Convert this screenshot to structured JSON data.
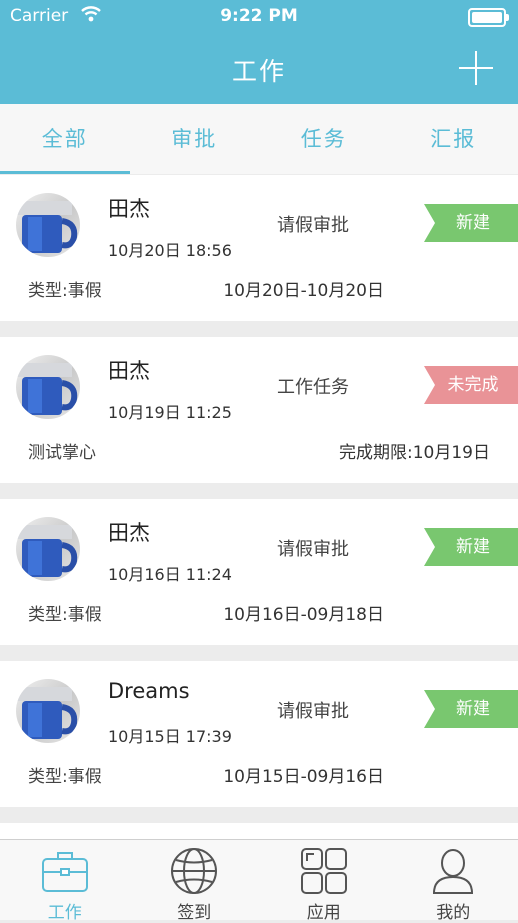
{
  "status": {
    "carrier": "Carrier",
    "time": "9:22 PM"
  },
  "header": {
    "title": "工作"
  },
  "tabs": [
    "全部",
    "审批",
    "任务",
    "汇报"
  ],
  "items": [
    {
      "name": "田杰",
      "datetime": "10月20日 18:56",
      "kind": "请假审批",
      "badge": "新建",
      "badge_color": "#79c76f",
      "left": "类型:事假",
      "right": "10月20日-10月20日"
    },
    {
      "name": "田杰",
      "datetime": "10月19日 11:25",
      "kind": "工作任务",
      "badge": "未完成",
      "badge_color": "#e99397",
      "left": "测试掌心",
      "right": "完成期限:10月19日"
    },
    {
      "name": "田杰",
      "datetime": "10月16日 11:24",
      "kind": "请假审批",
      "badge": "新建",
      "badge_color": "#79c76f",
      "left": "类型:事假",
      "right": "10月16日-09月18日"
    },
    {
      "name": "Dreams",
      "datetime": "10月15日 17:39",
      "kind": "请假审批",
      "badge": "新建",
      "badge_color": "#79c76f",
      "left": "类型:事假",
      "right": "10月15日-09月16日"
    }
  ],
  "tabbar": [
    {
      "label": "工作",
      "icon": "briefcase-icon"
    },
    {
      "label": "签到",
      "icon": "globe-icon"
    },
    {
      "label": "应用",
      "icon": "grid-icon"
    },
    {
      "label": "我的",
      "icon": "person-icon"
    }
  ],
  "colors": {
    "accent": "#5bbcd6",
    "new": "#79c76f",
    "incomplete": "#e99397"
  }
}
